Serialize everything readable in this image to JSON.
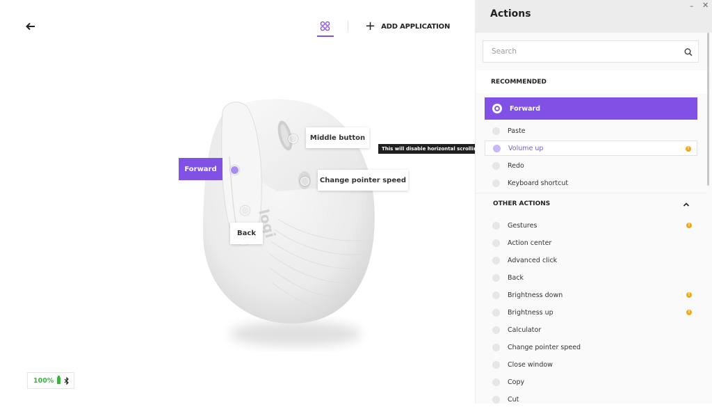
{
  "topbar": {
    "add_application_label": "ADD APPLICATION"
  },
  "device": {
    "callouts": {
      "forward": "Forward",
      "middle_button": "Middle button",
      "change_pointer_speed": "Change pointer speed",
      "back": "Back"
    },
    "tooltip": "This will disable horizontal scrolling",
    "logo_text": "logi",
    "battery_percent": "100%"
  },
  "panel": {
    "title": "Actions",
    "search_placeholder": "Search",
    "recommended_header": "RECOMMENDED",
    "recommended": [
      {
        "label": "Forward",
        "selected": true,
        "warning": false
      },
      {
        "label": "Paste",
        "selected": false,
        "warning": false
      },
      {
        "label": "Volume up",
        "selected": false,
        "warning": true,
        "hovered": true
      },
      {
        "label": "Redo",
        "selected": false,
        "warning": false
      },
      {
        "label": "Keyboard shortcut",
        "selected": false,
        "warning": false
      }
    ],
    "other_header": "OTHER ACTIONS",
    "other": [
      {
        "label": "Gestures",
        "warning": true
      },
      {
        "label": "Action center",
        "warning": false
      },
      {
        "label": "Advanced click",
        "warning": false
      },
      {
        "label": "Back",
        "warning": false
      },
      {
        "label": "Brightness down",
        "warning": true
      },
      {
        "label": "Brightness up",
        "warning": true
      },
      {
        "label": "Calculator",
        "warning": false
      },
      {
        "label": "Change pointer speed",
        "warning": false
      },
      {
        "label": "Close window",
        "warning": false
      },
      {
        "label": "Copy",
        "warning": false
      },
      {
        "label": "Cut",
        "warning": false
      }
    ],
    "warning_glyph": "!"
  },
  "colors": {
    "accent": "#8151e6",
    "warning": "#f1a816",
    "battery": "#3cb43c"
  },
  "icons": [
    "back-arrow-icon",
    "buttons-grid-icon",
    "plus-icon",
    "battery-icon",
    "bluetooth-icon",
    "search-icon",
    "chevron-up-icon",
    "minimize-icon",
    "close-icon",
    "warning-icon"
  ]
}
